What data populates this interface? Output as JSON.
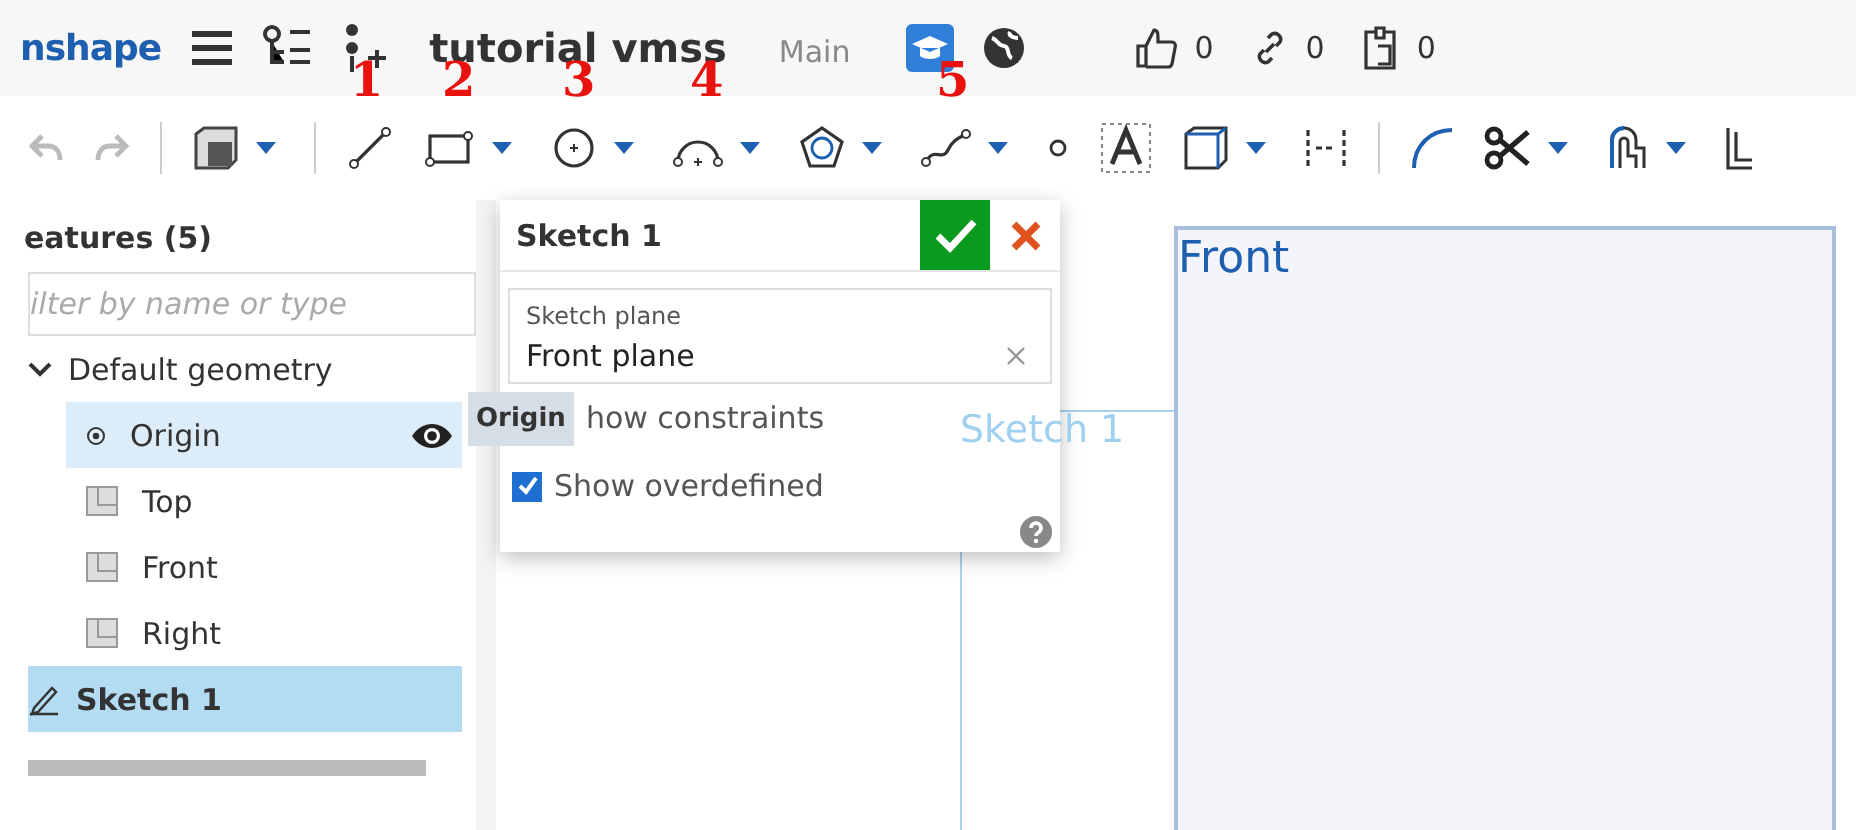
{
  "header": {
    "logo": "nshape",
    "document_title": "tutorial vmss",
    "branch": "Main",
    "counters": [
      {
        "kind": "likes",
        "value": "0"
      },
      {
        "kind": "links",
        "value": "0"
      },
      {
        "kind": "copies",
        "value": "0"
      }
    ]
  },
  "annotations": [
    "1",
    "2",
    "3",
    "4",
    "5"
  ],
  "feature_list": {
    "title": "eatures (5)",
    "filter": {
      "placeholder": "ilter by name or type"
    },
    "items": [
      {
        "label": "Default geometry",
        "kind": "group",
        "expanded": true,
        "selected": false,
        "hovered": false,
        "children": [
          {
            "label": "Origin",
            "kind": "point",
            "selected": false,
            "hovered": true
          },
          {
            "label": "Top",
            "kind": "plane",
            "selected": false,
            "hovered": false
          },
          {
            "label": "Front",
            "kind": "plane",
            "selected": false,
            "hovered": false
          },
          {
            "label": "Right",
            "kind": "plane",
            "selected": false,
            "hovered": false
          }
        ]
      },
      {
        "label": "Sketch 1",
        "kind": "sketch",
        "selected": true,
        "hovered": false
      }
    ]
  },
  "tooltip": {
    "text": "Origin"
  },
  "dialog": {
    "title": "Sketch 1",
    "plane_field": {
      "label": "Sketch plane",
      "value": "Front plane"
    },
    "options": [
      {
        "kind": "covered",
        "label": "how constraints"
      },
      {
        "kind": "checkbox",
        "label": "Show overdefined",
        "checked": true
      }
    ]
  },
  "canvas": {
    "plane_label": "Front",
    "sketch_label": "Sketch 1"
  }
}
